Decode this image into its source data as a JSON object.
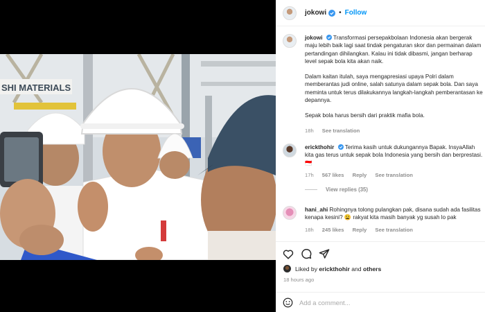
{
  "header": {
    "username": "jokowi",
    "separator": "•",
    "follow_label": "Follow"
  },
  "caption": {
    "username": "jokowi",
    "paragraphs": [
      "Transformasi persepakbolaan Indonesia akan bergerak maju lebih baik lagi saat tindak pengaturan skor dan permainan dalam pertandingan dihilangkan. Kalau ini tidak dibasmi, jangan berharap level sepak bola kita akan naik.",
      "Dalam kaitan itulah, saya mengapresiasi upaya Polri dalam memberantas judi online, salah satunya dalam sepak bola. Dan saya meminta untuk terus dilakukannya langkah-langkah pemberantasan ke depannya.",
      "Sepak bola harus bersih dari praktik mafia bola."
    ],
    "time": "18h",
    "see_translation": "See translation"
  },
  "comments": [
    {
      "username": "erickthohir",
      "text": "Terima kasih untuk dukungannya Bapak. InsyaAllah kita gas terus untuk sepak bola Indonesia yang bersih dan berprestasi. 🇮🇩",
      "time": "17h",
      "likes": "567 likes",
      "reply": "Reply",
      "see_translation": "See translation",
      "view_replies": "View replies (35)"
    },
    {
      "username": "hani_ahi",
      "text": "Rohingnya tolong pulangkan pak, disana sudah ada fasilitas kenapa kesini? 😩 rakyat kita masih banyak yg susah lo pak",
      "time": "18h",
      "likes": "245 likes",
      "reply": "Reply",
      "see_translation": "See translation"
    }
  ],
  "liked_by": {
    "prefix": "Liked by",
    "user": "erickthohir",
    "and": "and",
    "others": "others"
  },
  "posted_ago": "18 hours ago",
  "add_comment_placeholder": "Add a comment...",
  "photo_sign_text": "SHI MATERIALS",
  "icons": [
    "heart-icon",
    "comment-icon",
    "share-icon",
    "verified-badge-icon",
    "emoji-icon"
  ],
  "colors": {
    "link": "#0095f6",
    "verified": "#3897f0",
    "secondary": "#8e8e8e"
  }
}
